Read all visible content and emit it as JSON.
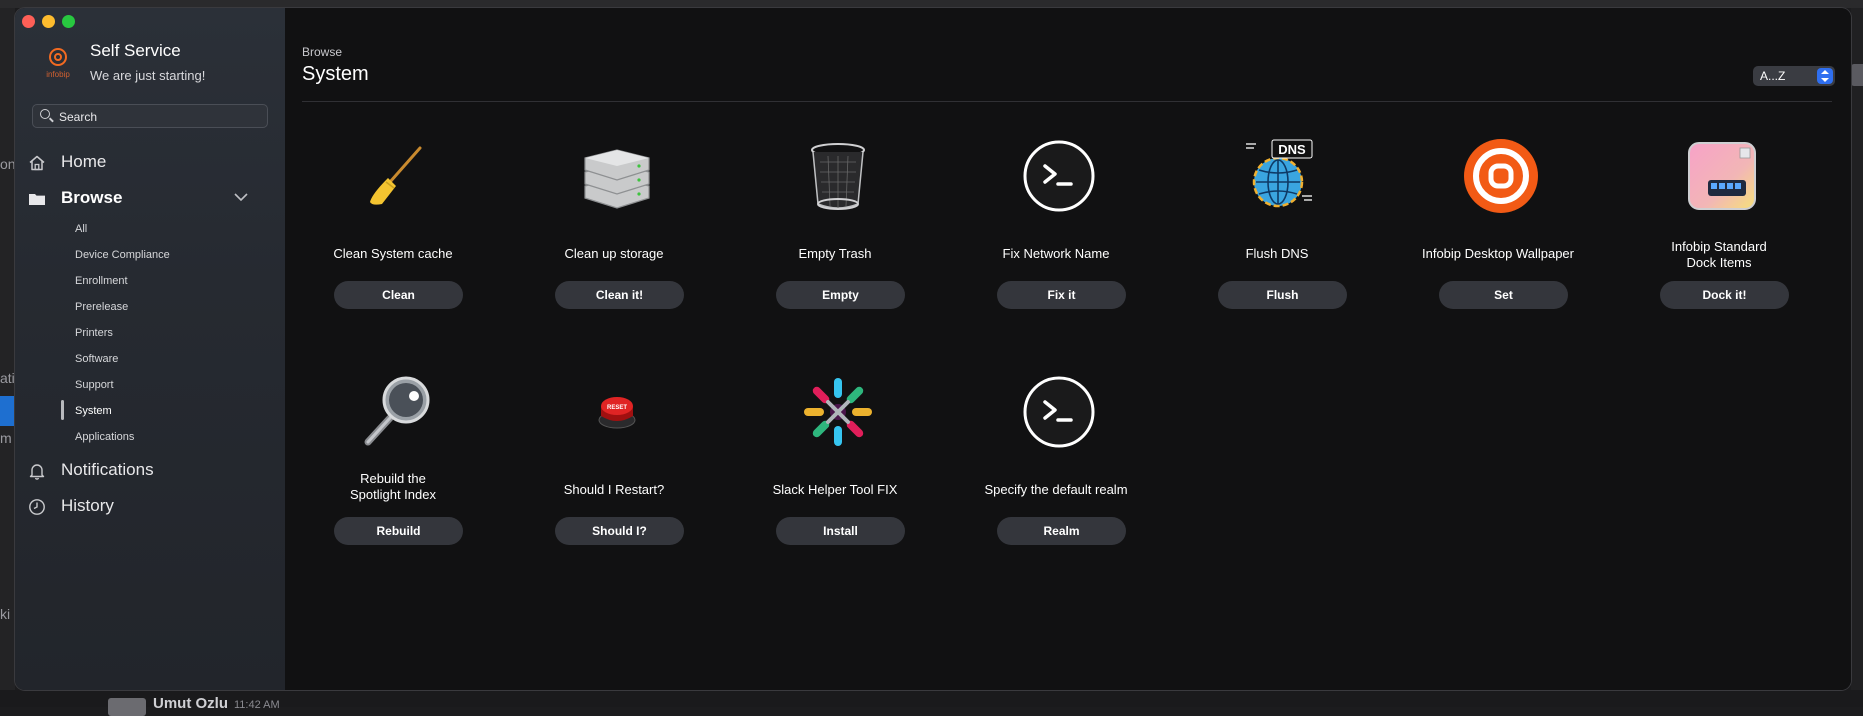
{
  "app": {
    "title": "Self Service",
    "subtitle": "We are just starting!",
    "logo_text": "infobip"
  },
  "search": {
    "placeholder": "Search"
  },
  "nav": {
    "home": "Home",
    "browse": "Browse",
    "browse_items": [
      "All",
      "Device Compliance",
      "Enrollment",
      "Prerelease",
      "Printers",
      "Software",
      "Support",
      "System",
      "Applications"
    ],
    "selected": "System",
    "notifications": "Notifications",
    "history": "History"
  },
  "main": {
    "breadcrumb": "Browse",
    "title": "System",
    "sort_label": "A...Z"
  },
  "items": [
    {
      "name": "Clean System cache",
      "button": "Clean",
      "icon": "broom-icon"
    },
    {
      "name": "Clean up storage",
      "button": "Clean it!",
      "icon": "disk-stack-icon"
    },
    {
      "name": "Empty Trash",
      "button": "Empty",
      "icon": "trash-icon"
    },
    {
      "name": "Fix Network Name",
      "button": "Fix it",
      "icon": "terminal-icon"
    },
    {
      "name": "Flush DNS",
      "button": "Flush",
      "icon": "dns-globe-icon"
    },
    {
      "name": "Infobip Desktop Wallpaper",
      "button": "Set",
      "icon": "infobip-logo-icon"
    },
    {
      "name": "Infobip Standard Dock Items",
      "button": "Dock it!",
      "icon": "dock-icon"
    },
    {
      "name": "Rebuild the Spotlight Index",
      "button": "Rebuild",
      "icon": "magnifier-icon"
    },
    {
      "name": "Should I Restart?",
      "button": "Should I?",
      "icon": "reset-button-icon",
      "icon_text": "RESET"
    },
    {
      "name": "Slack Helper Tool FIX",
      "button": "Install",
      "icon": "slack-icon"
    },
    {
      "name": "Specify the default realm",
      "button": "Realm",
      "icon": "terminal-icon"
    }
  ],
  "dns_label": "DNS",
  "background": {
    "user_name": "Umut Ozlu",
    "time": "11:42 AM",
    "fragments": [
      "on",
      "ati",
      "m",
      "ki"
    ]
  },
  "colors": {
    "accent": "#2f6ff0",
    "infobip_orange": "#f26a21",
    "button_bg": "#34363c"
  }
}
